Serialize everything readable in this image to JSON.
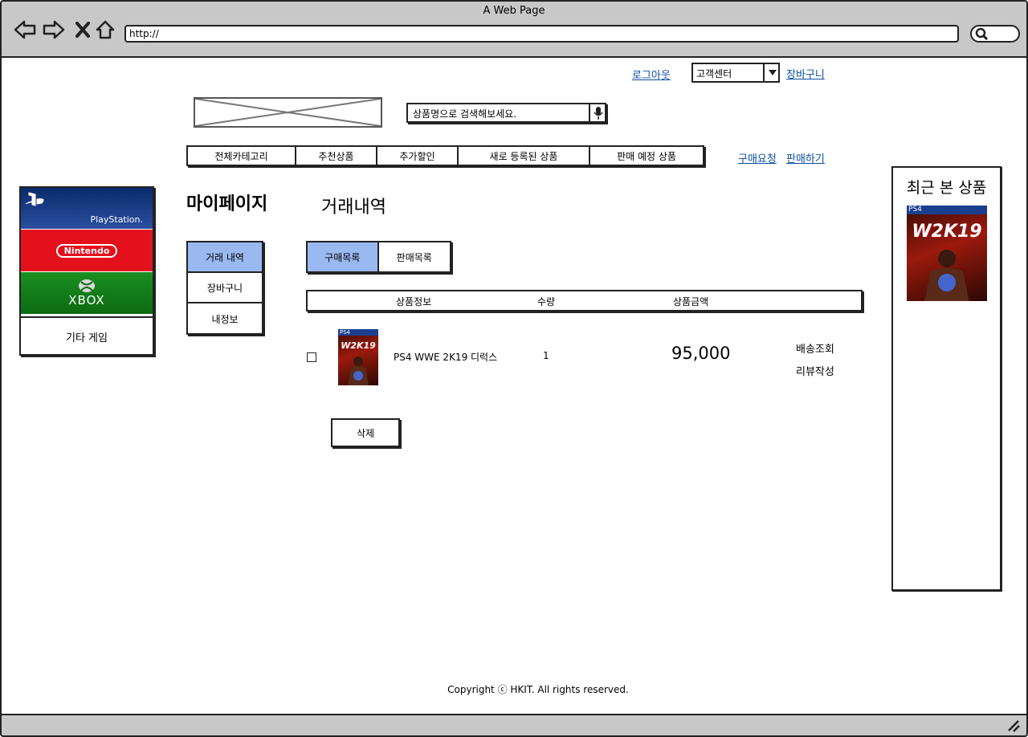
{
  "browser": {
    "window_title": "A Web Page",
    "url": "http://"
  },
  "header": {
    "logout": "로그아웃",
    "customer_center": "고객센터",
    "cart": "장바구니",
    "search_placeholder": "상품명으로 검색해보세요.",
    "purchase_request": "구매요청",
    "sell": "판매하기"
  },
  "categories": [
    "전체카테고리",
    "추천상품",
    "추가할인",
    "새로 등록된 상품",
    "판매 예정 상품"
  ],
  "brands": {
    "playstation": "PlayStation.",
    "nintendo": "Nintendo",
    "xbox": "XBOX",
    "other": "기타 게임"
  },
  "mypage": {
    "title": "마이페이지",
    "section_title": "거래내역",
    "menu": [
      "거래 내역",
      "장바구니",
      "내정보"
    ]
  },
  "tabs": [
    "구매목록",
    "판매목록"
  ],
  "table": {
    "headers": [
      "상품정보",
      "수량",
      "상품금액"
    ],
    "rows": [
      {
        "name": "PS4 WWE 2K19 디럭스",
        "quantity": "1",
        "price": "95,000",
        "actions": [
          "배송조회",
          "리뷰작성"
        ]
      }
    ]
  },
  "delete_button": "삭제",
  "recent": {
    "title": "최근 본 상품"
  },
  "cover_art": {
    "platform_band": "PS4",
    "logo_text": "W2K19"
  },
  "footer": "Copyright ⓒ HKIT. All rights reserved.",
  "colors": {
    "active_tab": "#9ab9f0",
    "link": "#0c4fa0",
    "playstation": "#16357a",
    "nintendo": "#e4101c",
    "xbox": "#13851c",
    "chrome": "#c8c8c8"
  }
}
